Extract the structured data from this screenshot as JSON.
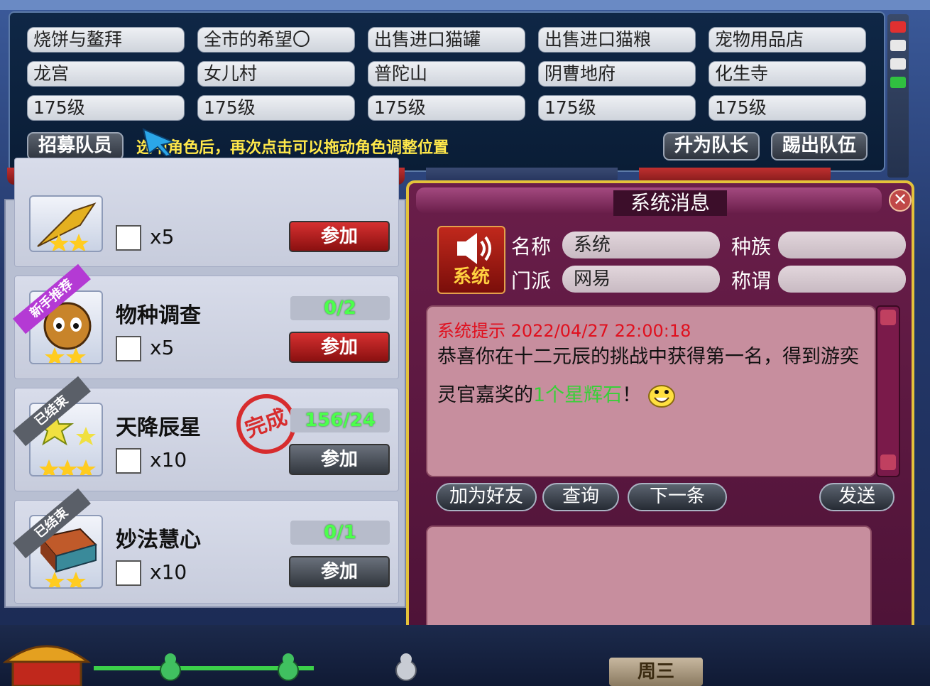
{
  "team_panel": {
    "row1": [
      "烧饼与鳌拜",
      "全市的希望〇",
      "出售进口猫罐",
      "出售进口猫粮",
      "宠物用品店"
    ],
    "row2": [
      "龙宫",
      "女儿村",
      "普陀山",
      "阴曹地府",
      "化生寺"
    ],
    "row3": [
      "175级",
      "175级",
      "175级",
      "175级",
      "175级"
    ],
    "recruit_button": "招募队员",
    "hint_text": "选中角色后，再次点击可以拖动角色调整位置",
    "promote_button": "升为队长",
    "kick_button": "踢出队伍"
  },
  "quests": [
    {
      "name": "",
      "reward_count": "x5",
      "progress": "",
      "join_label": "参加",
      "ribbon": "",
      "completed": false,
      "join_style": "red",
      "stars": 2
    },
    {
      "name": "物种调查",
      "reward_count": "x5",
      "progress": "0/2",
      "join_label": "参加",
      "ribbon": "新手推荐",
      "completed": false,
      "join_style": "red",
      "stars": 2
    },
    {
      "name": "天降辰星",
      "reward_count": "x10",
      "progress": "156/24",
      "join_label": "参加",
      "ribbon": "已结束",
      "completed": true,
      "stamp": "完成",
      "join_style": "gray",
      "stars": 3
    },
    {
      "name": "妙法慧心",
      "reward_count": "x10",
      "progress": "0/1",
      "join_label": "参加",
      "ribbon": "已结束",
      "completed": false,
      "join_style": "gray",
      "stars": 2
    }
  ],
  "system_message": {
    "title": "系统消息",
    "avatar_label": "系统",
    "name_label": "名称",
    "name_value": "系统",
    "race_label": "种族",
    "race_value": "",
    "faction_label": "门派",
    "faction_value": "网易",
    "title_label": "称谓",
    "title_value": "",
    "msg_header": "系统提示  2022/04/27  22:00:18",
    "msg_part1": "恭喜你在十二元辰的挑战中获得第一名，得到游奕灵官嘉奖的",
    "msg_highlight": "1个星辉石",
    "msg_part2": "！",
    "btn_add_friend": "加为好友",
    "btn_query": "查询",
    "btn_next": "下一条",
    "btn_send": "发送"
  },
  "bottom": {
    "weekday_label": "周三"
  },
  "colors": {
    "accent_gold": "#e4c23a",
    "progress_green": "#4cff4c",
    "message_red": "#e0101e"
  }
}
